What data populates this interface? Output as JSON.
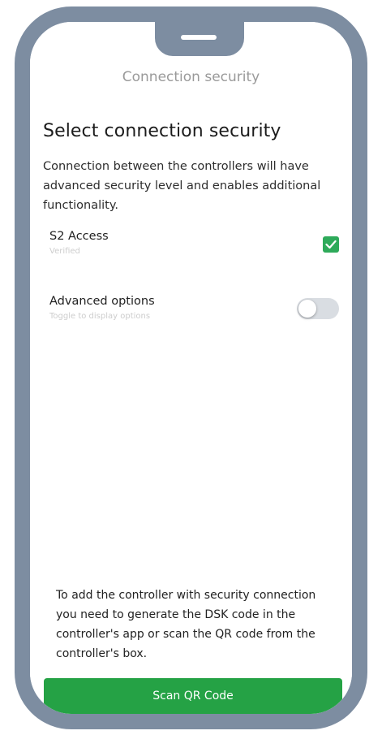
{
  "header": {
    "title": "Connection security"
  },
  "main": {
    "section_title": "Select connection security",
    "description": "Connection between the controllers will have advanced security level and enables additional functionality.",
    "options": [
      {
        "label": "S2 Access",
        "sublabel": "Verified",
        "control": "checkbox",
        "checked": true
      },
      {
        "label": "Advanced options",
        "sublabel": "Toggle to display options",
        "control": "toggle",
        "checked": false
      }
    ],
    "info_text": "To add the controller with security connection you need to generate the DSK code in the controller's app or scan the QR code from the controller's box."
  },
  "footer": {
    "scan_button_label": "Scan QR Code"
  },
  "colors": {
    "accent_green": "#25a245",
    "checkbox_green": "#2eaa5a",
    "frame": "#7d8da1",
    "toggle_off": "#d9dde2"
  },
  "icons": {
    "checkbox_check": "check-icon"
  }
}
